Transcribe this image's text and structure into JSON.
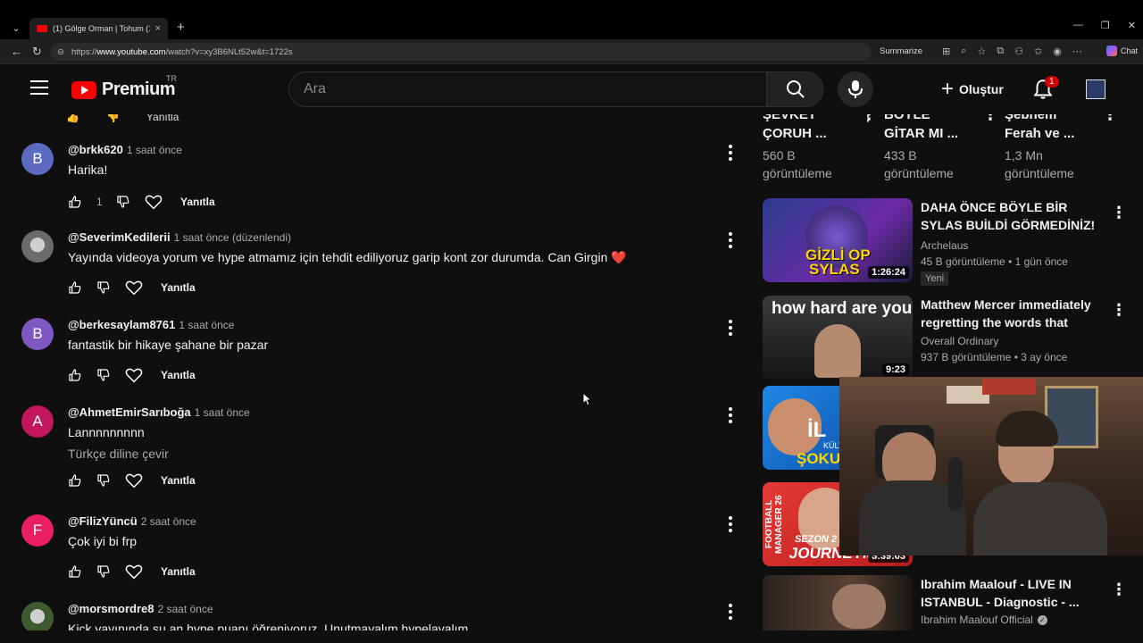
{
  "browser": {
    "tab_title": "(1) Gölge Orman | Tohum (1. Bölüm",
    "url_prefix": "https://",
    "url_host": "www.youtube.com",
    "url_path": "/watch?v=xy3B6NLt52w&t=1722s",
    "summarize_label": "Summarize",
    "chat_label": "Chat"
  },
  "header": {
    "logo_text": "Premium",
    "region": "TR",
    "search_placeholder": "Ara",
    "create_label": "Oluştur",
    "notification_count": "1"
  },
  "comment_stub": {
    "reply_label": "Yanıtla"
  },
  "comments": [
    {
      "avatar_letter": "B",
      "avatar_color": "#5c6bc0",
      "user": "@brkk620",
      "time": "1 saat önce",
      "text": "Harika!",
      "likes": "1",
      "reply_label": "Yanıtla"
    },
    {
      "avatar_letter": "",
      "avatar_color": "#6b6b6b",
      "user": "@SeverimKedilerii",
      "time": "1 saat önce (düzenlendi)",
      "text": "Yayında videoya yorum ve hype atmamız için tehdit ediliyoruz garip kont zor durumda. Can Girgin ❤️",
      "likes": "",
      "reply_label": "Yanıtla"
    },
    {
      "avatar_letter": "B",
      "avatar_color": "#7e57c2",
      "user": "@berkesaylam8761",
      "time": "1 saat önce",
      "text": "fantastik bir hikaye şahane bir pazar",
      "likes": "",
      "reply_label": "Yanıtla"
    },
    {
      "avatar_letter": "A",
      "avatar_color": "#c2185b",
      "user": "@AhmetEmirSarıboğa",
      "time": "1 saat önce",
      "text": "Lannnnnnnnn",
      "translate": "Türkçe diline çevir",
      "likes": "",
      "reply_label": "Yanıtla"
    },
    {
      "avatar_letter": "F",
      "avatar_color": "#e91e63",
      "user": "@FilizYüncü",
      "time": "2 saat önce",
      "text": "Çok iyi bi frp",
      "likes": "",
      "reply_label": "Yanıtla"
    },
    {
      "avatar_letter": "",
      "avatar_color": "#3e5a2e",
      "user": "@morsmordre8",
      "time": "2 saat önce",
      "text": "Kick yayınında şu an hype puanı öğreniyoruz. Unutmayalım hypelayalım",
      "likes": "",
      "reply_label": "Yanıtla"
    }
  ],
  "shorts": [
    {
      "title_line1": "ŞEVKET",
      "title_line2": "ÇORUH ...",
      "views": "560 B",
      "views_label": "görüntüleme"
    },
    {
      "title_line1": "BÖYLE",
      "title_line2": "GİTAR MI ...",
      "views": "433 B",
      "views_label": "görüntüleme"
    },
    {
      "title_line1": "Şebnem",
      "title_line2": "Ferah ve ...",
      "views": "1,3 Mn",
      "views_label": "görüntüleme"
    }
  ],
  "videos": [
    {
      "title": "DAHA ÖNCE BÖYLE BİR SYLAS BUİLDİ GÖRMEDİNİZ! | KARA ...",
      "channel": "Archelaus",
      "meta": "45 B görüntüleme • 1 gün önce",
      "badge": "Yeni",
      "duration": "1:26:24",
      "thumb_text_1": "GİZLİ OP",
      "thumb_text_2": "SYLAS"
    },
    {
      "title": "Matthew Mercer immediately regretting the words that com...",
      "channel": "Overall Ordinary",
      "meta": "937 B görüntüleme • 3 ay önce",
      "duration": "9:23",
      "thumb_text_1": "how hard are you?"
    },
    {
      "title": "",
      "channel": "",
      "meta": "",
      "duration": "",
      "thumb_text_1": "İL",
      "thumb_text_2": "ŞOKU",
      "thumb_text_3": "KÜLT"
    },
    {
      "title": "",
      "channel": "",
      "meta": "",
      "duration": "3:39:03",
      "thumb_text_1": "FOOTBALL MANAGER 26",
      "thumb_text_2": "SEZON 2",
      "thumb_text_3": "JOURNEYMAN"
    },
    {
      "title": "Ibrahim Maalouf - LIVE IN ISTANBUL - Diagnostic - ...",
      "channel": "Ibrahim Maalouf Official",
      "meta": "",
      "duration": ""
    }
  ]
}
